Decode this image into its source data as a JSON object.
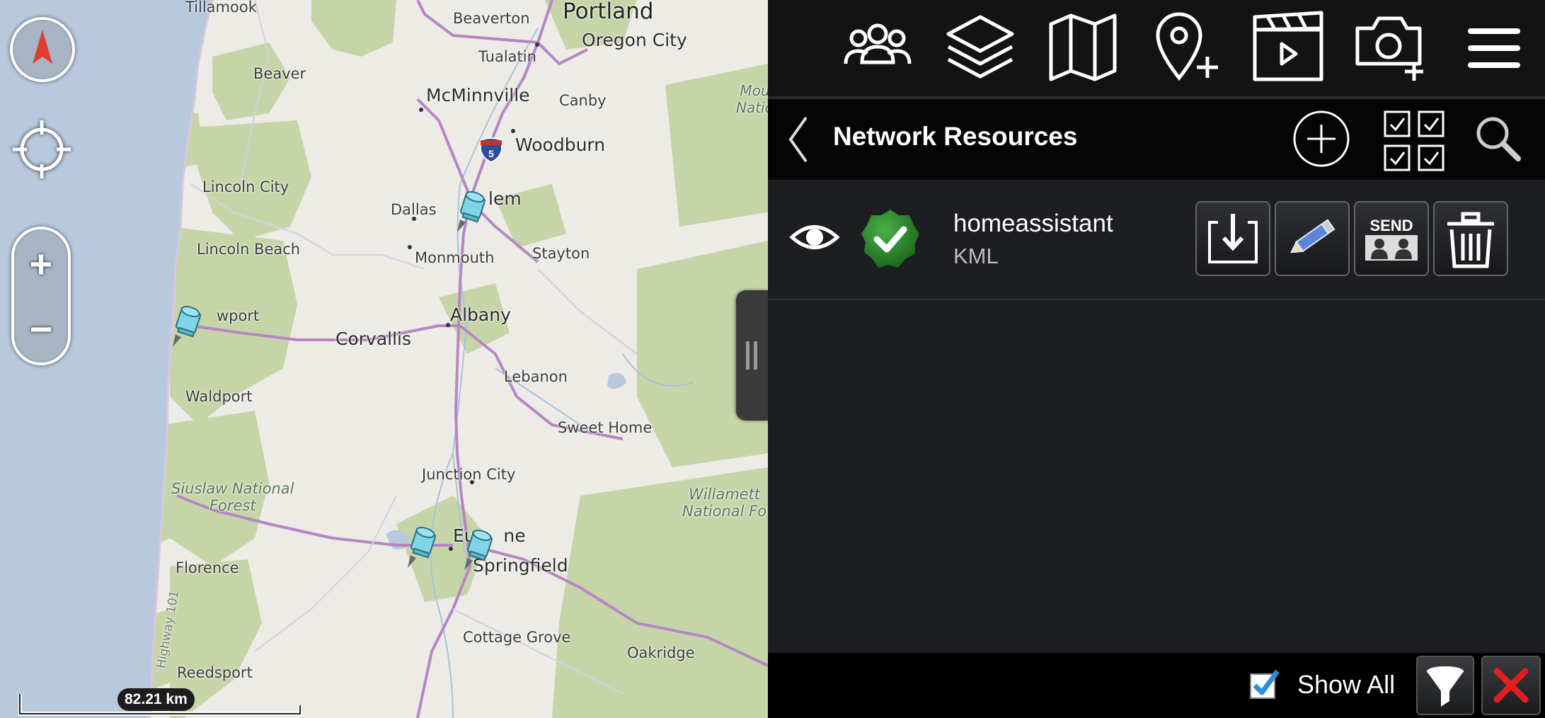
{
  "map": {
    "cities": [
      {
        "id": "tillamook",
        "label": "Tillamook"
      },
      {
        "id": "beaverton",
        "label": "Beaverton"
      },
      {
        "id": "portland",
        "label": "Portland"
      },
      {
        "id": "oregon-city",
        "label": "Oregon City"
      },
      {
        "id": "tualatin",
        "label": "Tualatin"
      },
      {
        "id": "beaver",
        "label": "Beaver"
      },
      {
        "id": "mcminnville",
        "label": "McMinnville"
      },
      {
        "id": "canby",
        "label": "Canby"
      },
      {
        "id": "woodburn",
        "label": "Woodburn"
      },
      {
        "id": "lincoln-city",
        "label": "Lincoln City"
      },
      {
        "id": "dallas",
        "label": "Dallas"
      },
      {
        "id": "salem",
        "label": "lem"
      },
      {
        "id": "lincoln-beach",
        "label": "Lincoln Beach"
      },
      {
        "id": "monmouth",
        "label": "Monmouth"
      },
      {
        "id": "stayton",
        "label": "Stayton"
      },
      {
        "id": "newport",
        "label": "wport"
      },
      {
        "id": "albany",
        "label": "Albany"
      },
      {
        "id": "corvallis",
        "label": "Corvallis"
      },
      {
        "id": "waldport",
        "label": "Waldport"
      },
      {
        "id": "lebanon",
        "label": "Lebanon"
      },
      {
        "id": "sweet-home",
        "label": "Sweet Home"
      },
      {
        "id": "junction-city",
        "label": "Junction City"
      },
      {
        "id": "eugene",
        "label": "Eu     ne"
      },
      {
        "id": "springfield",
        "label": "Springfield"
      },
      {
        "id": "florence",
        "label": "Florence"
      },
      {
        "id": "cottage-grove",
        "label": "Cottage Grove"
      },
      {
        "id": "oakridge",
        "label": "Oakridge"
      },
      {
        "id": "reedsport",
        "label": "Reedsport"
      }
    ],
    "parks": {
      "siuslaw": "Siuslaw National\nForest",
      "willamette": "Willamett\nNational Fo",
      "mt_hood": "Mou\nNatio"
    },
    "highway_label": "Highway 101",
    "interstate_shield": "5",
    "scale_label": "82.21 km"
  },
  "toolbar": {
    "icons": [
      "contacts-icon",
      "layers-icon",
      "map-icon",
      "add-marker-icon",
      "video-icon",
      "camera-icon",
      "menu-icon"
    ]
  },
  "header": {
    "title": "Network Resources"
  },
  "resource": {
    "name": "homeassistant",
    "type": "KML",
    "send_label": "SEND"
  },
  "footer": {
    "show_all_label": "Show All",
    "show_all_checked": true
  },
  "colors": {
    "water": "#b5c6dc",
    "forest": "#c3d3a5",
    "land": "#ecebe6",
    "road_major": "#b07fc0",
    "pin": "#7fd4e6",
    "status_green": "#2f8a2f",
    "close_red": "#e02020"
  }
}
